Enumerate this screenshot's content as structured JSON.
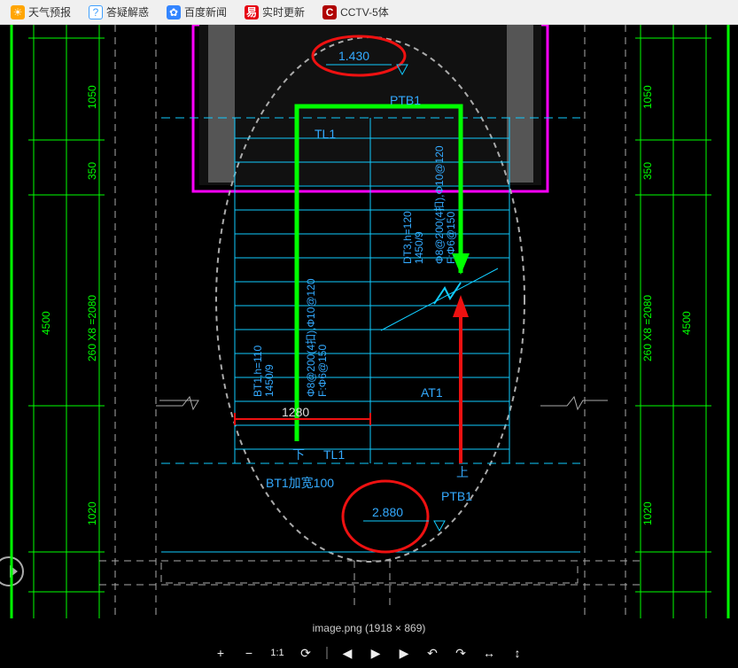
{
  "bookmarks": {
    "b0": {
      "label": "天气预报"
    },
    "b1": {
      "label": "答疑解惑"
    },
    "b2": {
      "label": "百度新闻"
    },
    "b3": {
      "label": "实时更新"
    },
    "b4": {
      "label": "CCTV-5体"
    }
  },
  "cad": {
    "elev_top": "1.430",
    "elev_bot": "2.880",
    "ptb1_top": "PTB1",
    "ptb1_bot": "PTB1",
    "tl1_top": "TL1",
    "tl1_bot": "TL1",
    "at1": "AT1",
    "bt1_note": "BT1加宽100",
    "down": "下",
    "up": "上",
    "dim_1280": "1280",
    "bt1_spec1": "BT1,h=110",
    "bt1_spec2": "1450/9",
    "bt1_spec3": "Φ8@200(4扣),Φ10@120",
    "bt1_spec4": "F:Φ6@150",
    "dt3_spec1": "DT3,h=120",
    "dt3_spec2": "1450/9",
    "dt3_spec3": "Φ8@200(4扣),Φ10@120",
    "dt3_spec4": "F:Φ6@150",
    "dim_1050_l": "1050",
    "dim_1050_r": "1050",
    "dim_350_l": "350",
    "dim_350_r": "350",
    "dim_4500_l": "4500",
    "dim_4500_r": "4500",
    "dim_260x8_l": "260 X8 =2080",
    "dim_260x8_r": "260 X8 =2080",
    "dim_1020_l": "1020",
    "dim_1020_r": "1020"
  },
  "caption": {
    "filename": "image.png",
    "dimensions": "(1918 × 869)"
  },
  "toolbar_icons": {
    "zoom_in": "+",
    "zoom_out": "−",
    "fit": "1:1",
    "rotate": "⟳",
    "prev": "◀",
    "play": "▶",
    "next": "▶",
    "undo": "↶",
    "redo": "↷",
    "fit_h": "↔",
    "fit_v": "↕"
  }
}
